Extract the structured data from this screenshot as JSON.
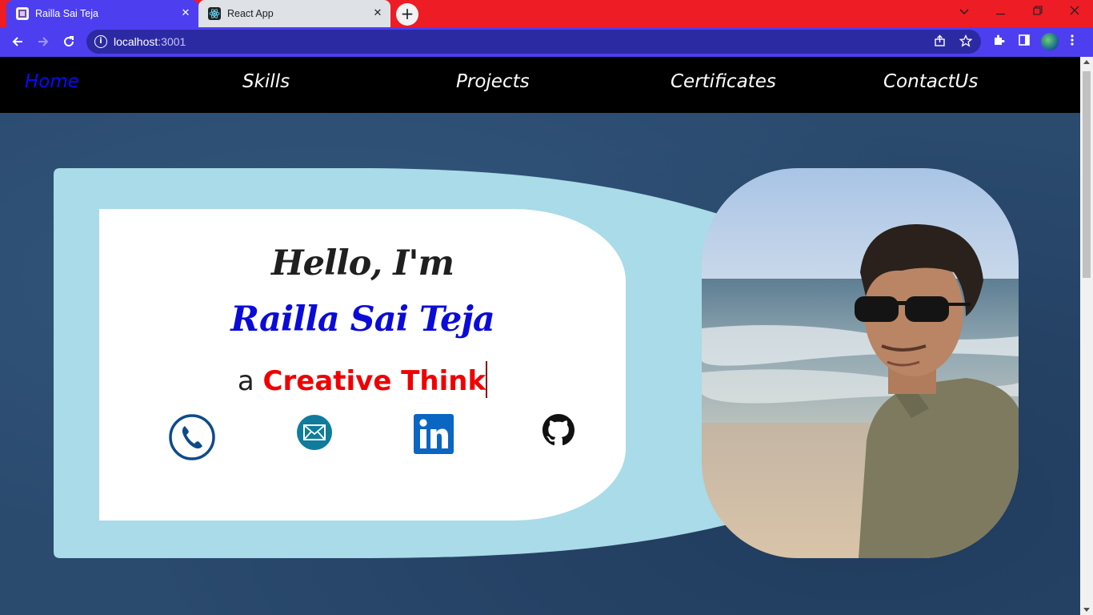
{
  "browser": {
    "tabs": [
      {
        "title": "Railla Sai Teja",
        "active": true
      },
      {
        "title": "React App",
        "active": false
      }
    ],
    "close_glyph": "✕",
    "new_tab_glyph": "+",
    "url_host": "localhost",
    "url_port": ":3001",
    "colors": {
      "tabstrip": "#ee1c25",
      "toolbar": "#4d3ff0",
      "omnibox": "#2c2aa3"
    }
  },
  "nav": {
    "items": [
      "Home",
      "Skills",
      "Projects",
      "Certificates",
      "ContactUs"
    ],
    "active": "Home"
  },
  "hero": {
    "greeting": "Hello, I'm",
    "name": "Railla Sai Teja",
    "tagline_prefix": "a",
    "tagline_highlight": "Creative Think"
  },
  "social_icons": [
    "phone-icon",
    "email-icon",
    "linkedin-icon",
    "github-icon"
  ],
  "colors": {
    "nav_active": "#0a0afb",
    "name": "#0b0bd8",
    "highlight": "#f00000",
    "card_outer": "#a9dbe8",
    "page_bg": "#2a4a6e"
  }
}
